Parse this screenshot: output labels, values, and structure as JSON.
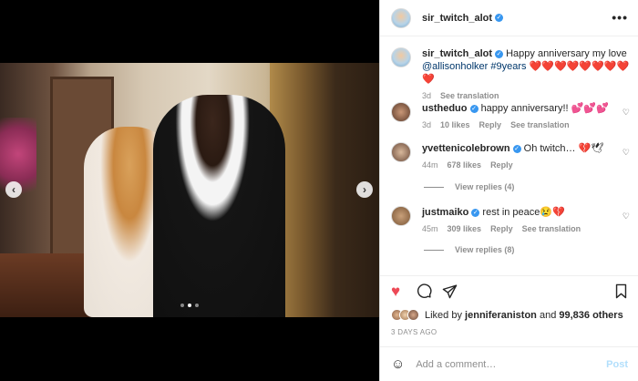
{
  "header": {
    "username": "sir_twitch_alot",
    "more_icon": "•••"
  },
  "caption": {
    "username": "sir_twitch_alot",
    "text": "Happy anniversary my love",
    "mention": "@allisonholker",
    "hashtag": "#9years",
    "hearts": "❤️❤️❤️❤️❤️❤️❤️❤️❤️",
    "time": "3d",
    "see_translation": "See translation"
  },
  "comments": [
    {
      "username": "ustheduo",
      "verified": true,
      "text": "happy anniversary!! 💕💕💕",
      "time": "3d",
      "likes": "10 likes",
      "reply": "Reply",
      "extra": "See translation"
    },
    {
      "username": "yvettenicolebrown",
      "verified": true,
      "text": "Oh twitch… 💔🕊",
      "time": "44m",
      "likes": "678 likes",
      "reply": "Reply",
      "extra": "",
      "view_replies": "View replies (4)"
    },
    {
      "username": "justmaiko",
      "verified": true,
      "text": "rest in peace😢💔",
      "time": "45m",
      "likes": "309 likes",
      "reply": "Reply",
      "extra": "See translation",
      "view_replies": "View replies (8)"
    }
  ],
  "likes": {
    "prefix": "Liked by",
    "user": "jenniferaniston",
    "conj": "and",
    "count": "99,836 others"
  },
  "date": "3 DAYS AGO",
  "add_comment": {
    "placeholder": "Add a comment…",
    "post_label": "Post"
  },
  "carousel": {
    "prev": "‹",
    "next": "›"
  },
  "colors": {
    "accent": "#3897f0",
    "like_red": "#ed4956",
    "post_disabled": "#b2dffc"
  }
}
